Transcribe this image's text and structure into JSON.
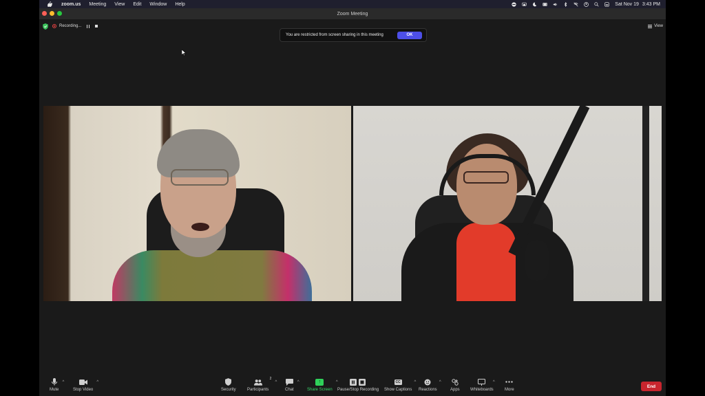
{
  "menubar": {
    "app_name": "zoom.us",
    "items": [
      "Meeting",
      "View",
      "Edit",
      "Window",
      "Help"
    ],
    "date": "Sat Nov 19",
    "time": "3:43 PM"
  },
  "window": {
    "title": "Zoom Meeting"
  },
  "topbar": {
    "recording_label": "Recording...",
    "view_label": "View"
  },
  "banner": {
    "message": "You are restricted from screen sharing in this meeting",
    "ok_label": "OK"
  },
  "toolbar": {
    "mute": "Mute",
    "stop_video": "Stop Video",
    "security": "Security",
    "participants": "Participants",
    "participants_count": "2",
    "chat": "Chat",
    "share_screen": "Share Screen",
    "pause_stop_recording": "Pause/Stop Recording",
    "show_captions": "Show Captions",
    "captions_icon": "CC",
    "reactions": "Reactions",
    "apps": "Apps",
    "whiteboards": "Whiteboards",
    "more": "More",
    "end": "End"
  },
  "colors": {
    "ok_button": "#4d4fe8",
    "end_button": "#c8252e",
    "share_green": "#2fd15a",
    "recording_red": "#e44444"
  }
}
